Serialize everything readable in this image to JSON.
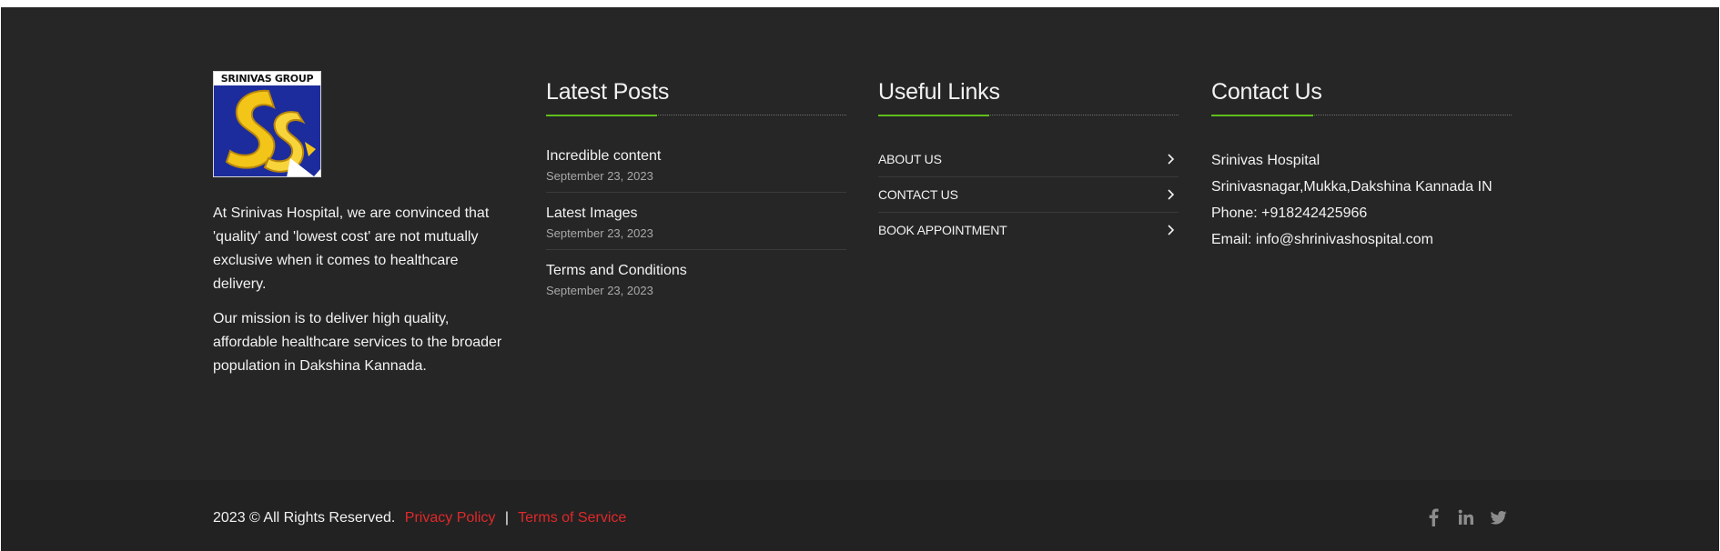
{
  "brand": {
    "logo_text": "SRINIVAS GROUP",
    "accent_green": "#5fbf1a",
    "link_red": "#e0282a",
    "background": "#262626"
  },
  "about": {
    "paragraphs": [
      "At Srinivas Hospital, we are convinced that 'quality' and 'lowest cost' are not mutually exclusive when it comes to healthcare delivery.",
      "Our mission is to deliver high quality, affordable healthcare services to the broader population in Dakshina Kannada."
    ]
  },
  "latest_posts": {
    "title": "Latest Posts",
    "items": [
      {
        "title": "Incredible content",
        "date": "September 23, 2023"
      },
      {
        "title": "Latest Images",
        "date": "September 23, 2023"
      },
      {
        "title": "Terms and Conditions",
        "date": "September 23, 2023"
      }
    ]
  },
  "useful_links": {
    "title": "Useful Links",
    "items": [
      {
        "label": "ABOUT US",
        "icon": "chevron-right-icon"
      },
      {
        "label": "CONTACT US",
        "icon": "chevron-right-icon"
      },
      {
        "label": "BOOK APPOINTMENT",
        "icon": "chevron-right-icon"
      }
    ]
  },
  "contact": {
    "title": "Contact Us",
    "lines": [
      "Srinivas Hospital",
      "Srinivasnagar,Mukka,Dakshina Kannada IN",
      "Phone: +918242425966",
      "Email: info@shrinivashospital.com"
    ]
  },
  "bottom_bar": {
    "copyright": "2023 © All Rights Reserved.",
    "privacy_label": "Privacy Policy",
    "separator": "|",
    "terms_label": "Terms of Service",
    "socials": [
      {
        "name": "facebook-icon"
      },
      {
        "name": "linkedin-icon"
      },
      {
        "name": "twitter-icon"
      }
    ]
  }
}
